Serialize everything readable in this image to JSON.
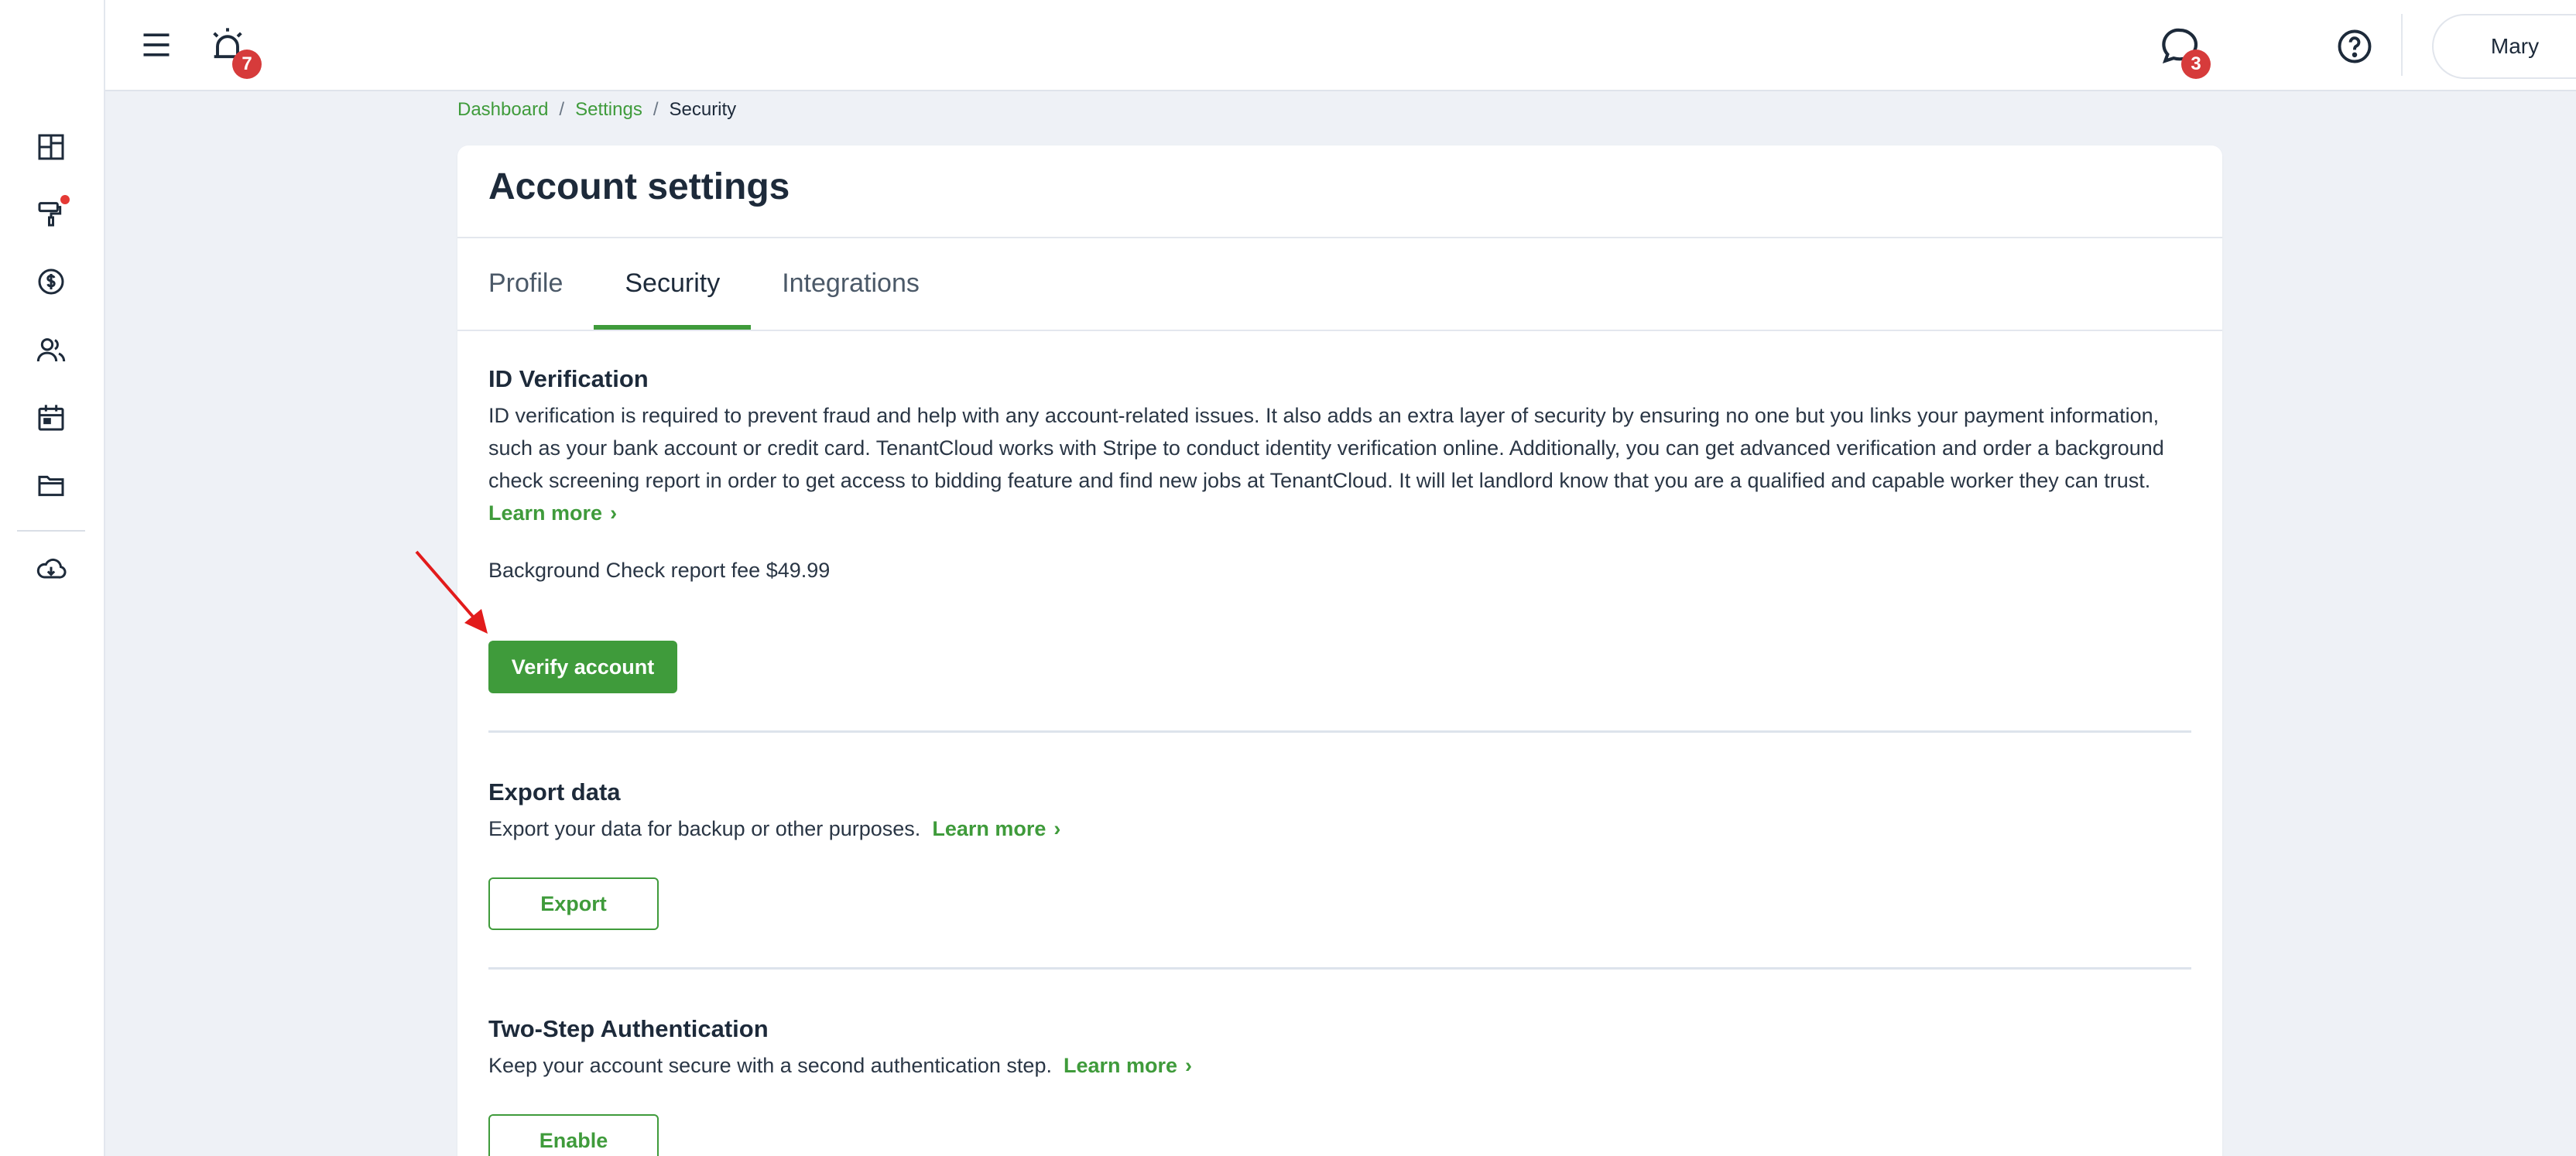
{
  "topbar": {
    "alarm_badge": "7",
    "chat_badge": "3",
    "user_name": "Mary"
  },
  "sidebar": {
    "items": [
      {
        "name": "dashboard-icon"
      },
      {
        "name": "maintenance-icon",
        "has_dot": true
      },
      {
        "name": "accounting-icon"
      },
      {
        "name": "people-icon"
      },
      {
        "name": "calendar-icon"
      },
      {
        "name": "folder-icon"
      },
      {
        "name": "cloud-download-icon"
      }
    ]
  },
  "breadcrumb": {
    "items": [
      "Dashboard",
      "Settings"
    ],
    "separator": "/",
    "current": "Security"
  },
  "page": {
    "title": "Account settings",
    "tabs": [
      {
        "label": "Profile",
        "active": false
      },
      {
        "label": "Security",
        "active": true
      },
      {
        "label": "Integrations",
        "active": false
      }
    ]
  },
  "id_verification": {
    "title": "ID Verification",
    "description": "ID verification is required to prevent fraud and help with any account-related issues. It also adds an extra layer of security by ensuring no one but you links your payment information, such as your bank account or credit card. TenantCloud works with Stripe to conduct identity verification online. Additionally, you can get advanced verification and order a background check screening report in order to get access to bidding feature and find new jobs at TenantCloud. It will let landlord know that you are a qualified and capable worker they can trust.",
    "learn_more": "Learn more",
    "fee_text": "Background Check report fee $49.99",
    "button": "Verify account"
  },
  "export_data": {
    "title": "Export data",
    "description": "Export your data for backup or other purposes.",
    "learn_more": "Learn more",
    "button": "Export"
  },
  "two_step": {
    "title": "Two-Step Authentication",
    "description": "Keep your account secure with a second authentication step.",
    "learn_more": "Learn more",
    "button": "Enable"
  },
  "colors": {
    "accent": "#3f9b3b",
    "badge": "#d63b3b",
    "annotation_arrow": "#e21b1b"
  }
}
